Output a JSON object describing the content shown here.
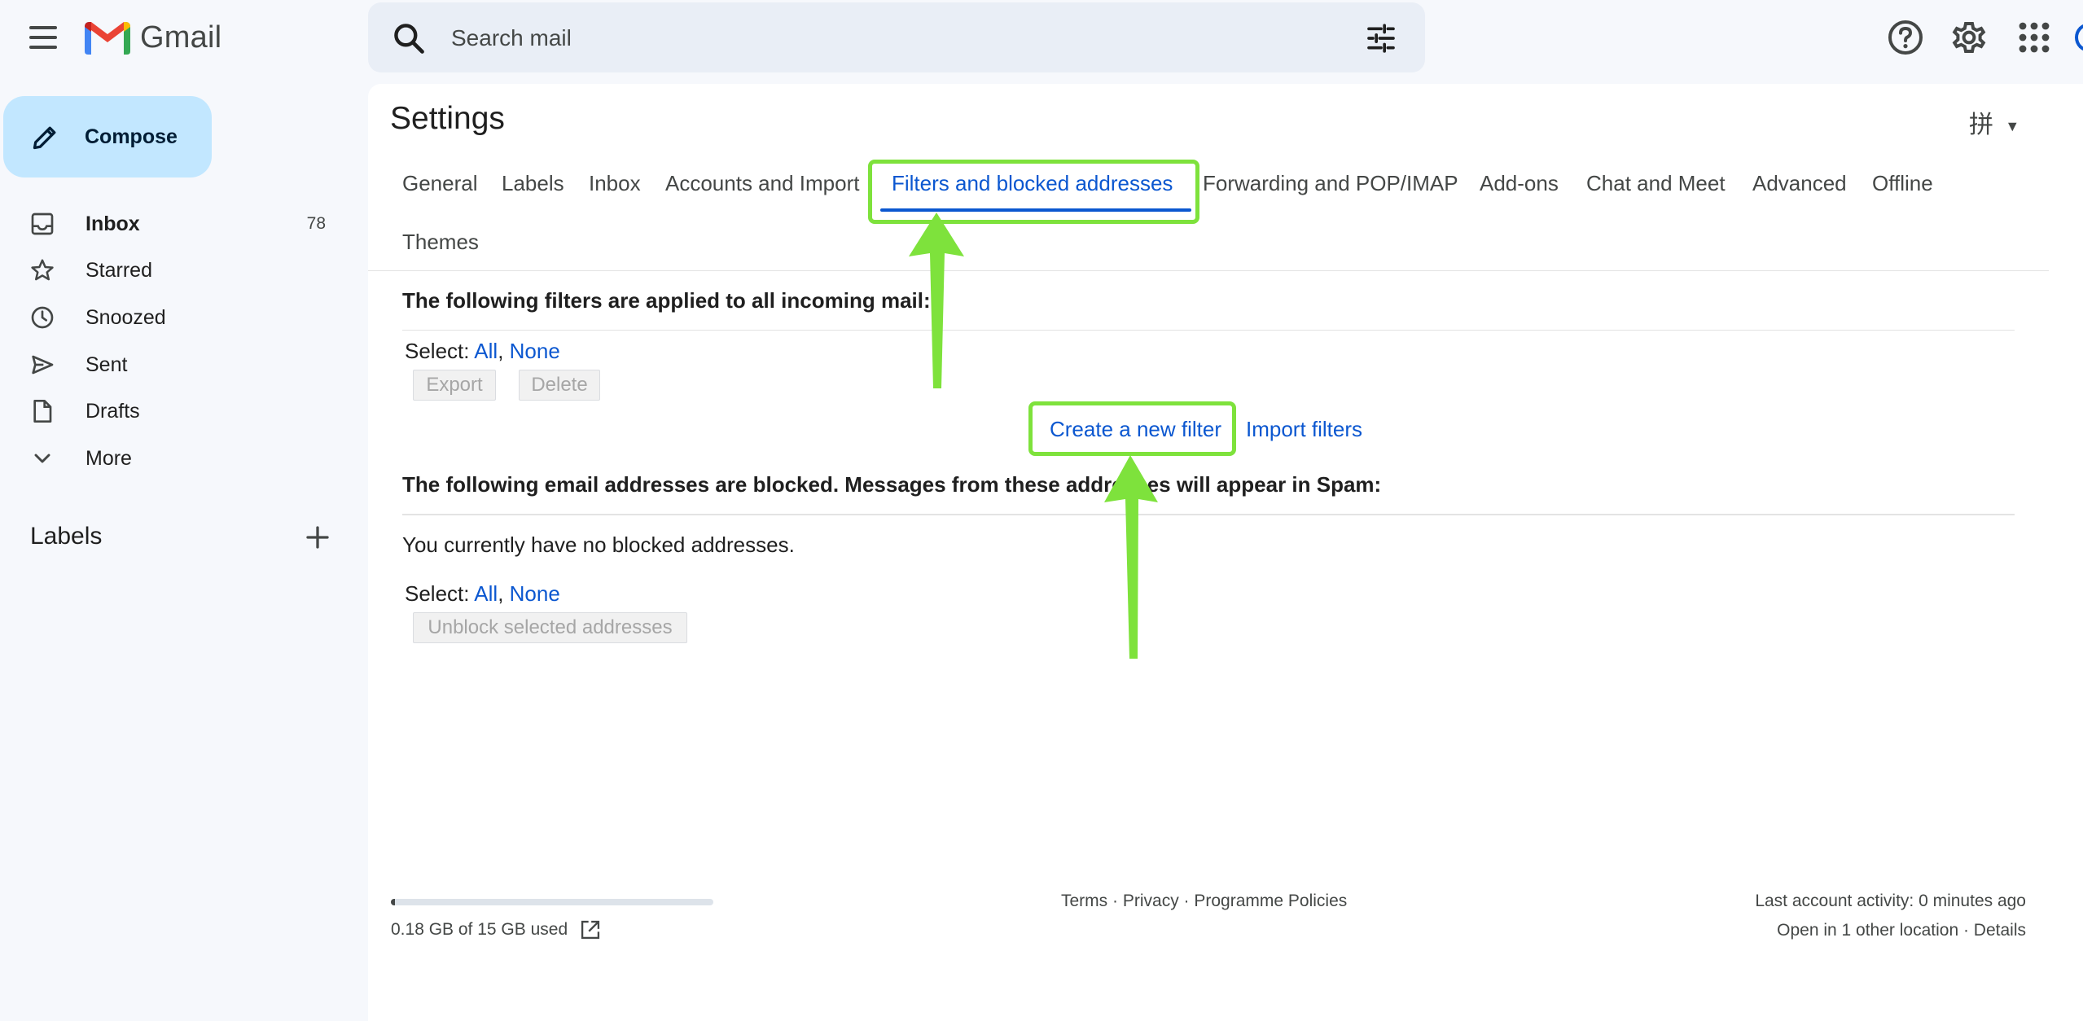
{
  "app": {
    "name": "Gmail"
  },
  "search": {
    "placeholder": "Search mail"
  },
  "sidebar": {
    "compose": "Compose",
    "items": [
      {
        "label": "Inbox",
        "count": "78",
        "icon": "inbox-icon",
        "bold": true
      },
      {
        "label": "Starred",
        "icon": "star-icon"
      },
      {
        "label": "Snoozed",
        "icon": "clock-icon"
      },
      {
        "label": "Sent",
        "icon": "send-icon"
      },
      {
        "label": "Drafts",
        "icon": "draft-icon"
      },
      {
        "label": "More",
        "icon": "chevron-down-icon"
      }
    ],
    "labels_heading": "Labels"
  },
  "settings": {
    "title": "Settings",
    "input_tool": "拼",
    "tabs": [
      "General",
      "Labels",
      "Inbox",
      "Accounts and Import",
      "Filters and blocked addresses",
      "Forwarding and POP/IMAP",
      "Add-ons",
      "Chat and Meet",
      "Advanced",
      "Offline",
      "Themes"
    ],
    "active_tab": "Filters and blocked addresses"
  },
  "filters": {
    "heading": "The following filters are applied to all incoming mail:",
    "select_prefix": "Select: ",
    "select_all": "All",
    "select_sep": ", ",
    "select_none": "None",
    "export_button": "Export",
    "delete_button": "Delete",
    "create_filter": "Create a new filter",
    "import_filters": "Import filters"
  },
  "blocked": {
    "heading": "The following email addresses are blocked. Messages from these addresses will appear in Spam:",
    "empty_text": "You currently have no blocked addresses.",
    "select_prefix": "Select: ",
    "select_all": "All",
    "select_sep": ", ",
    "select_none": "None",
    "unblock_button": "Unblock selected addresses"
  },
  "footer": {
    "storage_used": "0.18 GB of 15 GB used",
    "storage_fraction": 0.012,
    "terms": "Terms",
    "privacy": "Privacy",
    "policies": "Programme Policies",
    "dot": " · ",
    "last_activity": "Last account activity: 0 minutes ago",
    "open_in": "Open in 1 other location",
    "details": "Details"
  },
  "colors": {
    "accent": "#0b57d0",
    "compose_bg": "#c2e7ff",
    "annotation": "#7ee23c"
  }
}
